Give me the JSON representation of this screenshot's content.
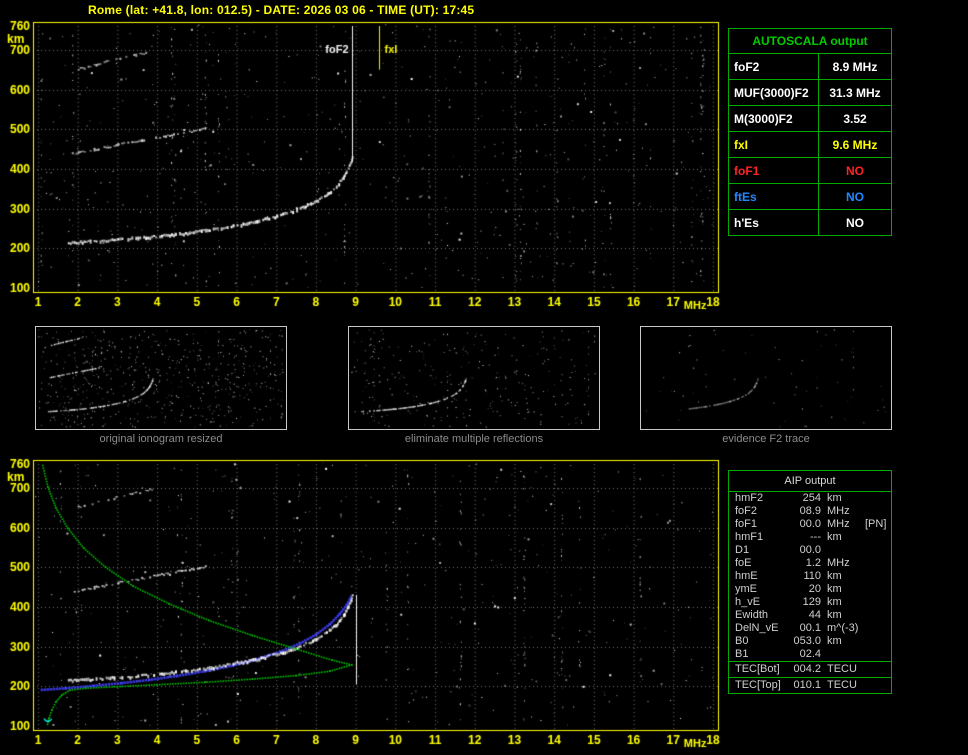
{
  "header": {
    "title": "Rome (lat: +41.8, lon: 012.5) - DATE: 2026 03 06 - TIME (UT): 17:45",
    "color": "#ffff00"
  },
  "autoscala": {
    "title": "AUTOSCALA output",
    "title_color": "#00cc00",
    "border_color": "#00aa00",
    "rows": [
      {
        "label": "foF2",
        "value": "8.9 MHz",
        "color": "#ffffff"
      },
      {
        "label": "MUF(3000)F2",
        "value": "31.3 MHz",
        "color": "#ffffff"
      },
      {
        "label": "M(3000)F2",
        "value": "3.52",
        "color": "#ffffff"
      },
      {
        "label": "fxI",
        "value": "9.6 MHz",
        "color": "#ffff00"
      },
      {
        "label": "foF1",
        "value": "NO",
        "color": "#ff2222"
      },
      {
        "label": "ftEs",
        "value": "NO",
        "color": "#2288ff"
      },
      {
        "label": "h'Es",
        "value": "NO",
        "color": "#ffffff"
      }
    ]
  },
  "thumbnails": {
    "caption_color": "#8c8c8c",
    "captions": [
      "original ionogram resized",
      "eliminate multiple reflections",
      "evidence F2 trace"
    ],
    "items": [
      {
        "seed": 21,
        "noise": 560,
        "hops": [
          0,
          1,
          2
        ],
        "alpha": 0.95,
        "fmin": 1
      },
      {
        "seed": 22,
        "noise": 270,
        "hops": [
          0
        ],
        "alpha": 0.95,
        "fmin": 1
      },
      {
        "seed": 23,
        "noise": 60,
        "hops": [
          0
        ],
        "alpha": 0.6,
        "fmin": 4
      }
    ]
  },
  "aip": {
    "title": "AIP output",
    "border_color": "#00aa00",
    "text_color": "#cfcfcf",
    "rows": [
      {
        "label": "hmF2",
        "value": "254",
        "unit": "km",
        "extra": ""
      },
      {
        "label": "foF2",
        "value": "08.9",
        "unit": "MHz",
        "extra": ""
      },
      {
        "label": "foF1",
        "value": "00.0",
        "unit": "MHz",
        "extra": "[PN]"
      },
      {
        "label": "hmF1",
        "value": "---",
        "unit": "km",
        "extra": ""
      },
      {
        "label": "D1",
        "value": "00.0",
        "unit": "",
        "extra": ""
      },
      {
        "label": "foE",
        "value": "1.2",
        "unit": "MHz",
        "extra": ""
      },
      {
        "label": "hmE",
        "value": "110",
        "unit": "km",
        "extra": ""
      },
      {
        "label": "ymE",
        "value": "20",
        "unit": "km",
        "extra": ""
      },
      {
        "label": "h_vE",
        "value": "129",
        "unit": "km",
        "extra": ""
      },
      {
        "label": "Ewidth",
        "value": "44",
        "unit": "km",
        "extra": ""
      },
      {
        "label": "DelN_vE",
        "value": "00.1",
        "unit": "m^(-3)",
        "extra": ""
      },
      {
        "label": "B0",
        "value": "053.0",
        "unit": "km",
        "extra": ""
      },
      {
        "label": "B1",
        "value": "02.4",
        "unit": "",
        "extra": ""
      }
    ],
    "tec_rows": [
      {
        "label": "TEC[Bot]",
        "value": "004.2",
        "unit": "TECU"
      },
      {
        "label": "TEC[Top]",
        "value": "010.1",
        "unit": "TECU"
      }
    ]
  },
  "chart_data": [
    {
      "id": "ionogram",
      "type": "scatter",
      "title": "recorded ionogram",
      "xlabel": "MHz",
      "ylabel": "km",
      "xlim": [
        1,
        18
      ],
      "ylim": [
        100,
        760
      ],
      "x_ticks": [
        1,
        2,
        3,
        4,
        5,
        6,
        7,
        8,
        9,
        10,
        11,
        12,
        13,
        14,
        15,
        16,
        17,
        18
      ],
      "y_ticks": [
        760,
        700,
        600,
        500,
        400,
        300,
        200,
        100
      ],
      "axis_color": "#ffff00",
      "grid_color": "#9c9c9c",
      "grid": true,
      "noise": {
        "count": 520,
        "streaks": 24,
        "seed": 101
      },
      "traces": [
        {
          "name": "F2 trace 1st hop",
          "color": "#ffffff",
          "width": 3,
          "skip": 0.15,
          "points": [
            [
              1.75,
              213
            ],
            [
              2.3,
              216
            ],
            [
              2.9,
              220
            ],
            [
              3.5,
              225
            ],
            [
              4.1,
              230
            ],
            [
              4.7,
              237
            ],
            [
              5.3,
              245
            ],
            [
              5.9,
              255
            ],
            [
              6.5,
              267
            ],
            [
              7.0,
              280
            ],
            [
              7.5,
              296
            ],
            [
              7.9,
              313
            ],
            [
              8.25,
              333
            ],
            [
              8.5,
              355
            ],
            [
              8.68,
              378
            ],
            [
              8.8,
              400
            ],
            [
              8.87,
              416
            ],
            [
              8.9,
              428
            ]
          ]
        },
        {
          "name": "F2 trace 2nd hop",
          "color": "#dddddd",
          "width": 2,
          "skip": 0.35,
          "points": [
            [
              1.85,
              437
            ],
            [
              2.4,
              448
            ],
            [
              3.0,
              460
            ],
            [
              3.6,
              471
            ],
            [
              4.2,
              482
            ],
            [
              4.75,
              492
            ],
            [
              5.2,
              501
            ]
          ]
        },
        {
          "name": "F2 trace 3rd hop",
          "color": "#cccccc",
          "width": 2,
          "skip": 0.45,
          "points": [
            [
              1.95,
              650
            ],
            [
              2.45,
              663
            ],
            [
              2.95,
              675
            ],
            [
              3.45,
              686
            ],
            [
              3.85,
              696
            ]
          ]
        }
      ],
      "markers": [
        {
          "label": "foF2",
          "freq_mhz": 8.9,
          "color": "#ffffff",
          "label_side": "left",
          "line_from_km": 760,
          "line_to_km": 420
        },
        {
          "label": "fxI",
          "freq_mhz": 9.6,
          "color": "#ffff00",
          "label_side": "right",
          "line_from_km": 760,
          "line_to_km": 650
        }
      ]
    },
    {
      "id": "aip_profile",
      "type": "scatter",
      "title": "ionogram with fitted trace and electron density profile",
      "xlabel": "MHz",
      "ylabel": "km",
      "xlim": [
        1,
        18
      ],
      "ylim": [
        100,
        760
      ],
      "x_ticks": [
        1,
        2,
        3,
        4,
        5,
        6,
        7,
        8,
        9,
        10,
        11,
        12,
        13,
        14,
        15,
        16,
        17,
        18
      ],
      "y_ticks": [
        760,
        700,
        600,
        500,
        400,
        300,
        200,
        100
      ],
      "axis_color": "#ffff00",
      "grid_color": "#9c9c9c",
      "grid": true,
      "noise": {
        "count": 420,
        "streaks": 16,
        "seed": 202
      },
      "traces": [
        {
          "name": "F2 trace 1st hop",
          "color": "#ffffff",
          "width": 3,
          "skip": 0.15,
          "points": [
            [
              1.75,
              213
            ],
            [
              2.3,
              216
            ],
            [
              2.9,
              220
            ],
            [
              3.5,
              225
            ],
            [
              4.1,
              230
            ],
            [
              4.7,
              237
            ],
            [
              5.3,
              245
            ],
            [
              5.9,
              255
            ],
            [
              6.5,
              267
            ],
            [
              7.0,
              280
            ],
            [
              7.5,
              296
            ],
            [
              7.9,
              313
            ],
            [
              8.25,
              333
            ],
            [
              8.5,
              355
            ],
            [
              8.68,
              378
            ],
            [
              8.8,
              400
            ],
            [
              8.87,
              416
            ],
            [
              8.9,
              428
            ]
          ]
        },
        {
          "name": "F2 trace 2nd hop",
          "color": "#dddddd",
          "width": 2,
          "skip": 0.35,
          "points": [
            [
              1.85,
              437
            ],
            [
              2.4,
              448
            ],
            [
              3.0,
              460
            ],
            [
              3.6,
              471
            ],
            [
              4.2,
              482
            ],
            [
              4.75,
              492
            ],
            [
              5.2,
              501
            ]
          ]
        },
        {
          "name": "F2 trace 3rd hop",
          "color": "#cccccc",
          "width": 2,
          "skip": 0.45,
          "points": [
            [
              1.95,
              650
            ],
            [
              2.45,
              663
            ],
            [
              2.95,
              675
            ],
            [
              3.45,
              686
            ],
            [
              3.85,
              696
            ]
          ]
        }
      ],
      "fit_trace": {
        "name": "autoscala fitted trace",
        "color": "#4040ff",
        "points": [
          [
            1.1,
            191
          ],
          [
            1.7,
            195
          ],
          [
            2.4,
            201
          ],
          [
            3.1,
            208
          ],
          [
            3.8,
            216
          ],
          [
            4.5,
            226
          ],
          [
            5.2,
            238
          ],
          [
            5.9,
            252
          ],
          [
            6.5,
            268
          ],
          [
            7.1,
            287
          ],
          [
            7.6,
            308
          ],
          [
            8.0,
            330
          ],
          [
            8.35,
            356
          ],
          [
            8.6,
            382
          ],
          [
            8.78,
            405
          ],
          [
            8.88,
            425
          ]
        ]
      },
      "profile": {
        "name": "electron density profile N(h)",
        "color": "#00cc00",
        "points_topside": [
          [
            1.12,
            756
          ],
          [
            1.25,
            702
          ],
          [
            1.45,
            650
          ],
          [
            1.75,
            598
          ],
          [
            2.15,
            548
          ],
          [
            2.7,
            500
          ],
          [
            3.4,
            452
          ],
          [
            4.3,
            408
          ],
          [
            5.3,
            366
          ],
          [
            6.4,
            328
          ],
          [
            7.5,
            294
          ],
          [
            8.4,
            266
          ],
          [
            8.9,
            254
          ]
        ],
        "points_bottomside": [
          [
            8.9,
            254
          ],
          [
            8.35,
            238
          ],
          [
            7.5,
            227
          ],
          [
            6.4,
            218
          ],
          [
            5.2,
            210
          ],
          [
            4.0,
            204
          ],
          [
            3.0,
            199
          ],
          [
            2.2,
            195
          ],
          [
            1.8,
            190
          ],
          [
            1.6,
            178
          ],
          [
            1.45,
            160
          ],
          [
            1.35,
            140
          ],
          [
            1.28,
            120
          ],
          [
            1.24,
            104
          ]
        ]
      },
      "e_marker": {
        "color": "#00e0e0",
        "freq_mhz": 1.25,
        "km": 122
      },
      "markers": [
        {
          "label": "",
          "freq_mhz": 9.0,
          "color": "#ffffff",
          "label_side": "left",
          "line_from_km": 430,
          "line_to_km": 205
        }
      ]
    }
  ]
}
